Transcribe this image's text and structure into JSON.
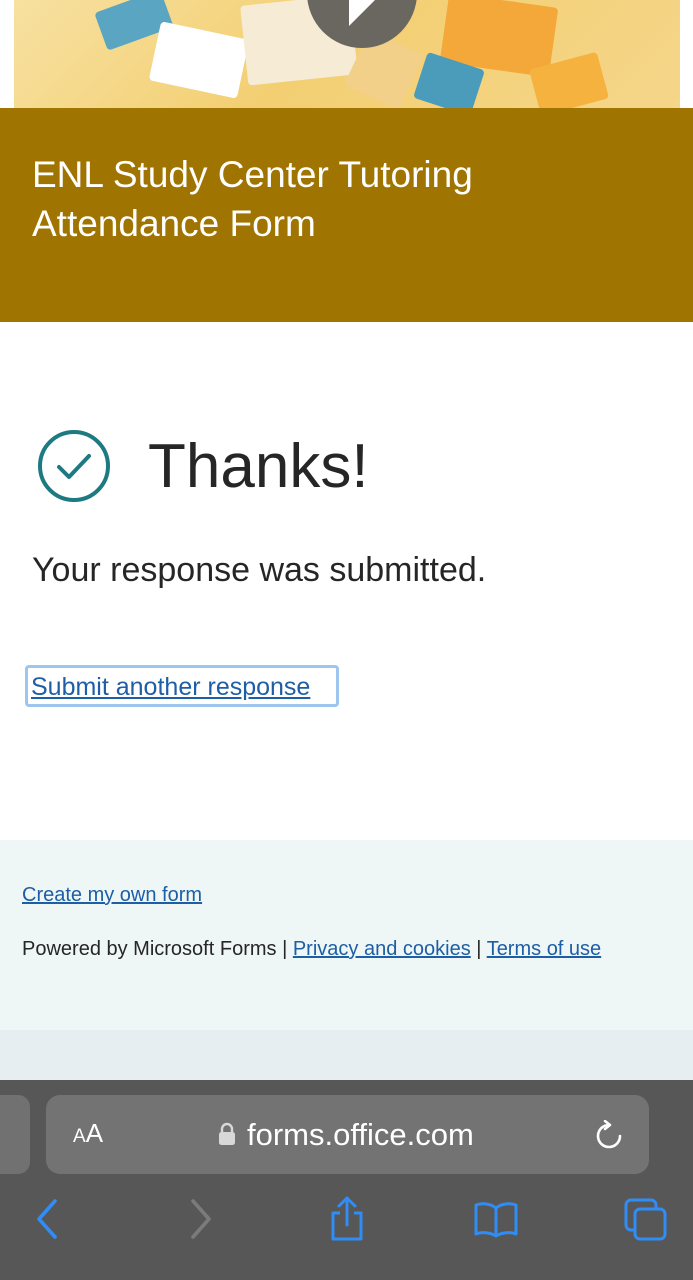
{
  "form": {
    "title": "ENL Study Center Tutoring Attendance Form"
  },
  "confirmation": {
    "heading": "Thanks!",
    "message": "Your response was submitted.",
    "submit_another_label": "Submit another response"
  },
  "footer": {
    "create_form_label": "Create my own form",
    "powered_by": "Powered by Microsoft Forms",
    "separator": "|",
    "privacy_label": "Privacy and cookies",
    "terms_label": "Terms of use"
  },
  "browser": {
    "text_size_label_small": "A",
    "text_size_label_large": "A",
    "url": "forms.office.com",
    "toolbar_icons": [
      "back-icon",
      "forward-icon",
      "share-icon",
      "bookmarks-icon",
      "tabs-icon"
    ]
  },
  "colors": {
    "header_band": "#a07400",
    "link": "#1d5ea5",
    "check_accent": "#1c7a80",
    "footer_bg": "#eef6f6",
    "browser_chrome": "#575757",
    "ios_blue": "#2f8df5"
  }
}
